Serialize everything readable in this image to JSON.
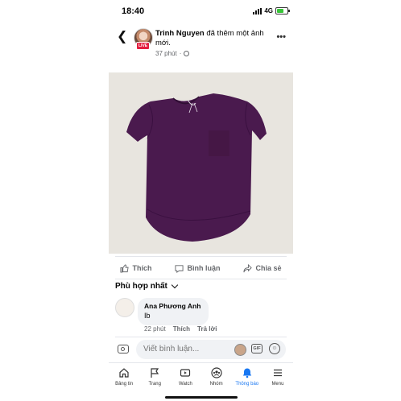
{
  "status_bar": {
    "time": "18:40",
    "network": "4G"
  },
  "post": {
    "author": "Trinh Nguyen",
    "action": " đã thêm một ảnh mới.",
    "live_badge": "LIVE",
    "time": "37 phút",
    "separator": "·",
    "more": "•••"
  },
  "actions": {
    "like": "Thích",
    "comment": "Bình luận",
    "share": "Chia sẻ"
  },
  "comments_sort": "Phù hợp nhất",
  "comment": {
    "name": "Ana Phương Anh",
    "text": "Ib",
    "time": "22 phút",
    "like": "Thích",
    "reply": "Trả lời"
  },
  "composer": {
    "placeholder": "Viết bình luận...",
    "gif": "GIF"
  },
  "tabs": [
    {
      "label": "Bảng tin",
      "icon": "home-icon"
    },
    {
      "label": "Trang",
      "icon": "flag-icon"
    },
    {
      "label": "Watch",
      "icon": "watch-icon"
    },
    {
      "label": "Nhóm",
      "icon": "groups-icon"
    },
    {
      "label": "Thông báo",
      "icon": "bell-icon",
      "active": true
    },
    {
      "label": "Menu",
      "icon": "menu-icon"
    }
  ],
  "colors": {
    "accent": "#1877f2",
    "shirt": "#4a1a4e",
    "live": "#e41e3f",
    "photo_bg": "#e6e3dd"
  }
}
